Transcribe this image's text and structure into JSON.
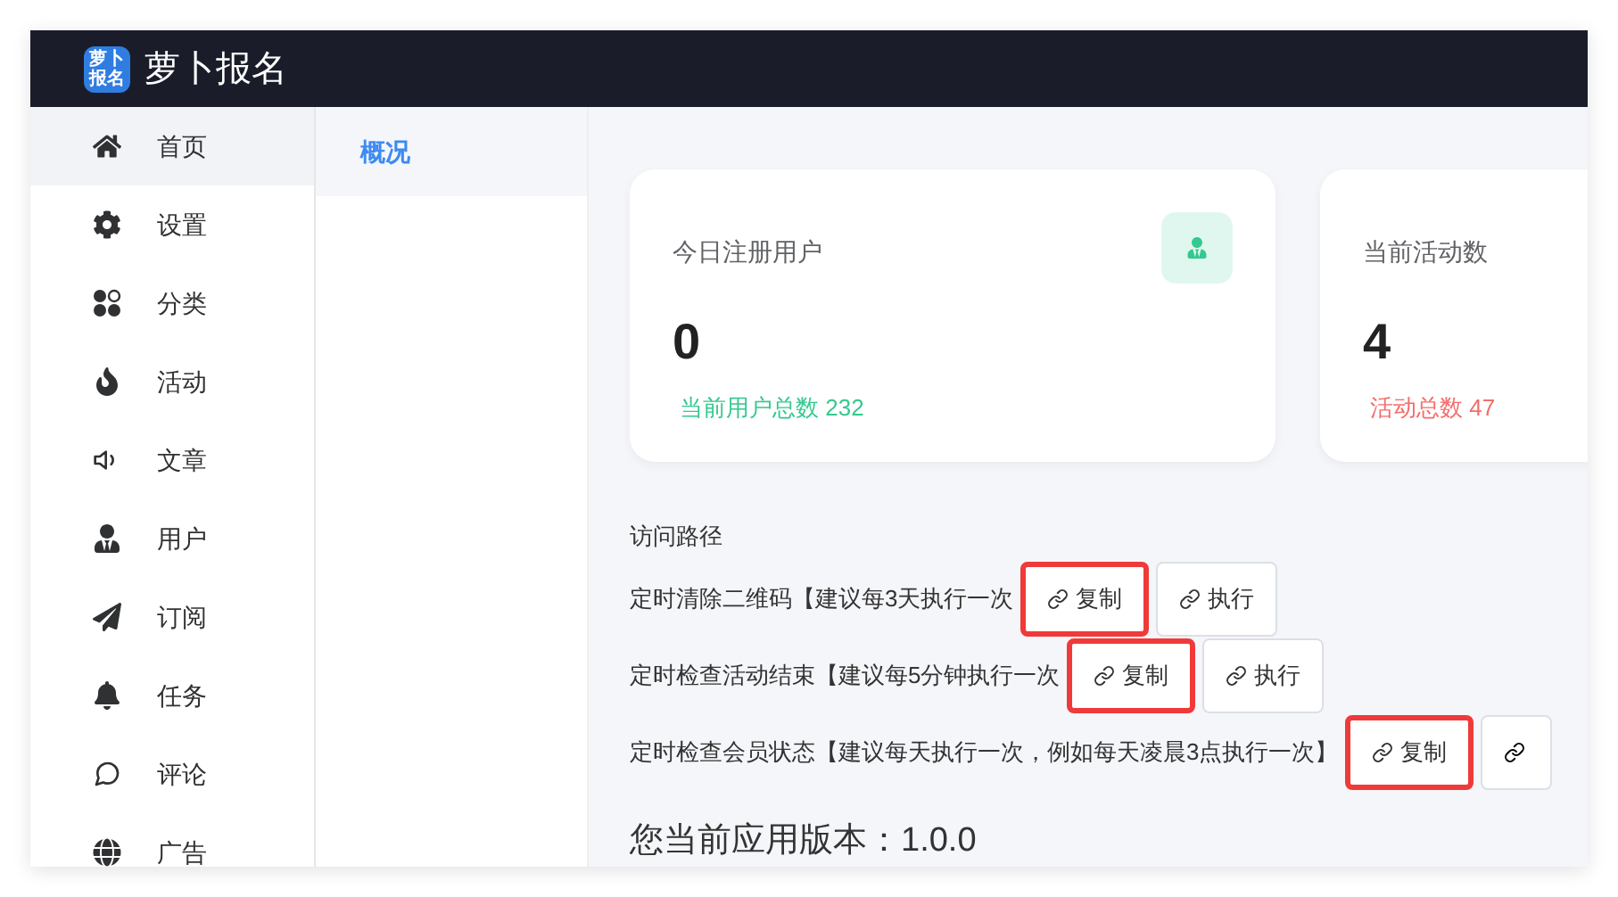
{
  "app": {
    "title": "萝卜报名",
    "logo_text": [
      "萝卜",
      "报名"
    ]
  },
  "sidebar": {
    "items": [
      {
        "label": "首页",
        "selected": true
      },
      {
        "label": "设置",
        "selected": false
      },
      {
        "label": "分类",
        "selected": false
      },
      {
        "label": "活动",
        "selected": false
      },
      {
        "label": "文章",
        "selected": false
      },
      {
        "label": "用户",
        "selected": false
      },
      {
        "label": "订阅",
        "selected": false
      },
      {
        "label": "任务",
        "selected": false
      },
      {
        "label": "评论",
        "selected": false
      },
      {
        "label": "广告",
        "selected": false
      }
    ]
  },
  "subnav": {
    "items": [
      {
        "label": "概况",
        "selected": true
      }
    ]
  },
  "stats": [
    {
      "title": "今日注册用户",
      "value": "0",
      "note": "当前用户总数 232",
      "color": "#34c98e"
    },
    {
      "title": "当前活动数",
      "value": "4",
      "note": "活动总数 47",
      "color": "#f56c6c"
    }
  ],
  "paths": {
    "title": "访问路径",
    "rows": [
      {
        "label": "定时清除二维码【建议每3天执行一次",
        "copy": "复制",
        "run": "执行",
        "highlighted": true
      },
      {
        "label": "定时检查活动结束【建议每5分钟执行一次",
        "copy": "复制",
        "run": "执行",
        "highlighted": true
      },
      {
        "label": "定时检查会员状态【建议每天执行一次，例如每天凌晨3点执行一次】",
        "copy": "复制",
        "highlighted": true
      }
    ]
  },
  "version": "您当前应用版本：1.0.0"
}
